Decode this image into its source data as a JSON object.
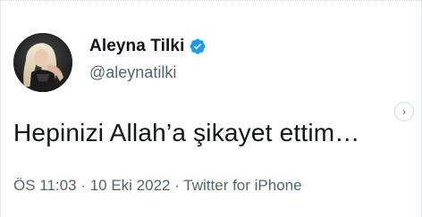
{
  "tweet": {
    "display_name": "Aleyna Tilki",
    "handle": "@aleynatilki",
    "text": "Hepinizi Allah’a şikayet ettim…",
    "time": "ÖS 11:03",
    "separator_1": " · ",
    "date": "10 Eki 2022",
    "separator_2": " · ",
    "source": "Twitter for iPhone"
  },
  "icons": {
    "verified": "verified-badge-icon",
    "next": "chevron-right-icon",
    "next_glyph": "›"
  },
  "colors": {
    "verified_blue": "#1d9bf0",
    "text_primary": "#0f1419",
    "text_secondary": "#536471",
    "border": "#e1e8ed"
  }
}
